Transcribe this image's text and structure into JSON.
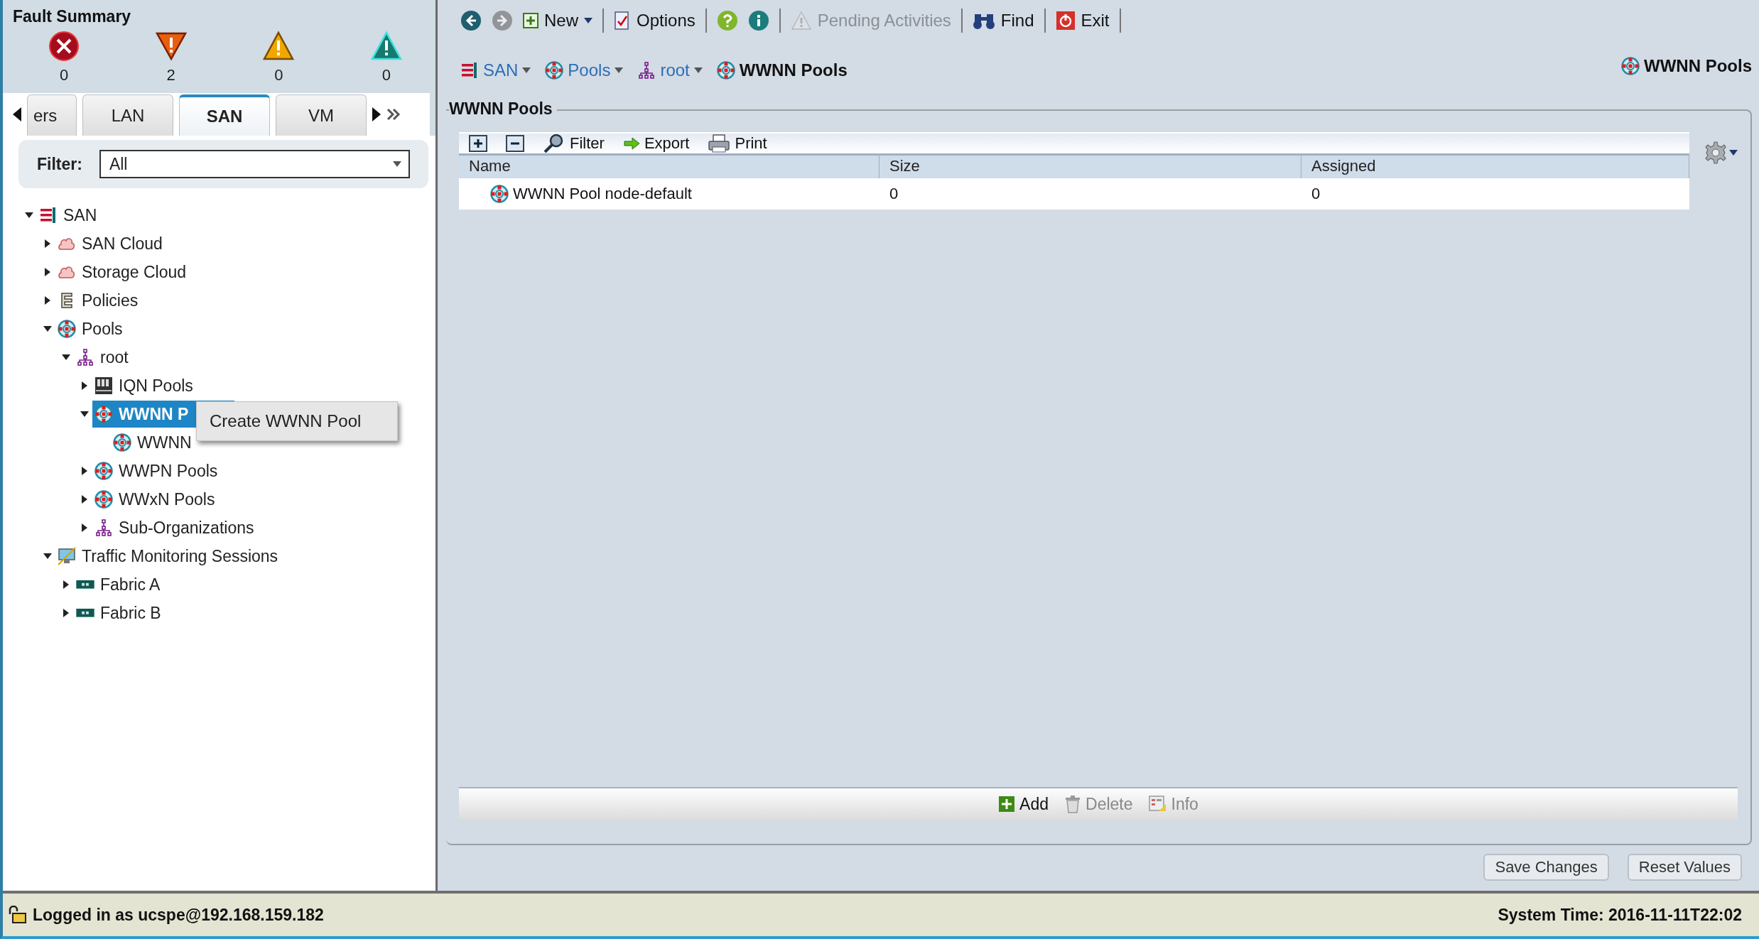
{
  "fault_summary": {
    "title": "Fault Summary",
    "faults": [
      {
        "kind": "critical",
        "count": "0"
      },
      {
        "kind": "major",
        "count": "2"
      },
      {
        "kind": "minor",
        "count": "0"
      },
      {
        "kind": "warning",
        "count": "0"
      }
    ]
  },
  "nav_tabs": [
    {
      "label": "ers",
      "selected": false
    },
    {
      "label": "LAN",
      "selected": false
    },
    {
      "label": "SAN",
      "selected": true
    },
    {
      "label": "VM",
      "selected": false
    }
  ],
  "filter": {
    "label": "Filter:",
    "value": "All"
  },
  "tree": [
    {
      "label": "SAN",
      "kind": "san",
      "expanded": true,
      "selected": false,
      "children": [
        {
          "label": "SAN Cloud",
          "kind": "cloud",
          "expanded": false,
          "selected": false
        },
        {
          "label": "Storage Cloud",
          "kind": "cloud",
          "expanded": false,
          "selected": false
        },
        {
          "label": "Policies",
          "kind": "policy",
          "expanded": false,
          "selected": false
        },
        {
          "label": "Pools",
          "kind": "pool",
          "expanded": true,
          "selected": false,
          "children": [
            {
              "label": "root",
              "kind": "org",
              "expanded": true,
              "selected": false,
              "children": [
                {
                  "label": "IQN Pools",
                  "kind": "iqn",
                  "expanded": false,
                  "selected": false
                },
                {
                  "label": "WWNN P",
                  "kind": "pool",
                  "expanded": true,
                  "selected": true,
                  "children": [
                    {
                      "label": "WWNN",
                      "kind": "pool",
                      "selected": false
                    }
                  ]
                },
                {
                  "label": "WWPN Pools",
                  "kind": "pool",
                  "expanded": false,
                  "selected": false
                },
                {
                  "label": "WWxN Pools",
                  "kind": "pool",
                  "expanded": false,
                  "selected": false
                },
                {
                  "label": "Sub-Organizations",
                  "kind": "org",
                  "expanded": false,
                  "selected": false
                }
              ]
            }
          ]
        },
        {
          "label": "Traffic Monitoring Sessions",
          "kind": "monitor",
          "expanded": true,
          "selected": false,
          "children": [
            {
              "label": "Fabric A",
              "kind": "fabric",
              "expanded": false,
              "selected": false
            },
            {
              "label": "Fabric B",
              "kind": "fabric",
              "expanded": false,
              "selected": false
            }
          ]
        }
      ]
    }
  ],
  "context_menu": {
    "items": [
      "Create WWNN Pool"
    ]
  },
  "toolbar": [
    {
      "kind": "back",
      "disabled": false
    },
    {
      "kind": "forward",
      "disabled": true
    },
    {
      "kind": "new",
      "label": "New",
      "disabled": false
    },
    {
      "kind": "options",
      "label": "Options",
      "disabled": false
    },
    {
      "kind": "help",
      "disabled": false
    },
    {
      "kind": "info",
      "disabled": false
    },
    {
      "kind": "pending",
      "label": "Pending Activities",
      "disabled": true
    },
    {
      "kind": "find",
      "label": "Find",
      "disabled": false
    },
    {
      "kind": "exit",
      "label": "Exit",
      "disabled": false
    }
  ],
  "breadcrumb": [
    {
      "label": "SAN",
      "kind": "san",
      "selected": false
    },
    {
      "label": "Pools",
      "kind": "pool",
      "selected": false
    },
    {
      "label": "root",
      "kind": "org",
      "selected": false
    },
    {
      "label": "WWNN Pools",
      "kind": "pool",
      "selected": true
    }
  ],
  "page_title": "WWNN Pools",
  "panel": {
    "title": "WWNN Pools",
    "table_tools": [
      {
        "kind": "expand"
      },
      {
        "kind": "collapse"
      },
      {
        "kind": "filter",
        "label": "Filter"
      },
      {
        "kind": "export",
        "label": "Export"
      },
      {
        "kind": "print",
        "label": "Print"
      }
    ],
    "columns": [
      "Name",
      "Size",
      "Assigned"
    ],
    "rows": [
      {
        "kind": "pool",
        "cells": [
          "WWNN Pool node-default",
          "0",
          "0"
        ]
      }
    ],
    "actions": [
      {
        "kind": "add",
        "label": "Add",
        "disabled": false
      },
      {
        "kind": "delete",
        "label": "Delete",
        "disabled": true
      },
      {
        "kind": "info",
        "label": "Info",
        "disabled": true
      }
    ]
  },
  "buttons": [
    "Save Changes",
    "Reset Values"
  ],
  "status_bar": {
    "login": "Logged in as ucspe@192.168.159.182",
    "time": "System Time: 2016-11-11T22:02"
  }
}
